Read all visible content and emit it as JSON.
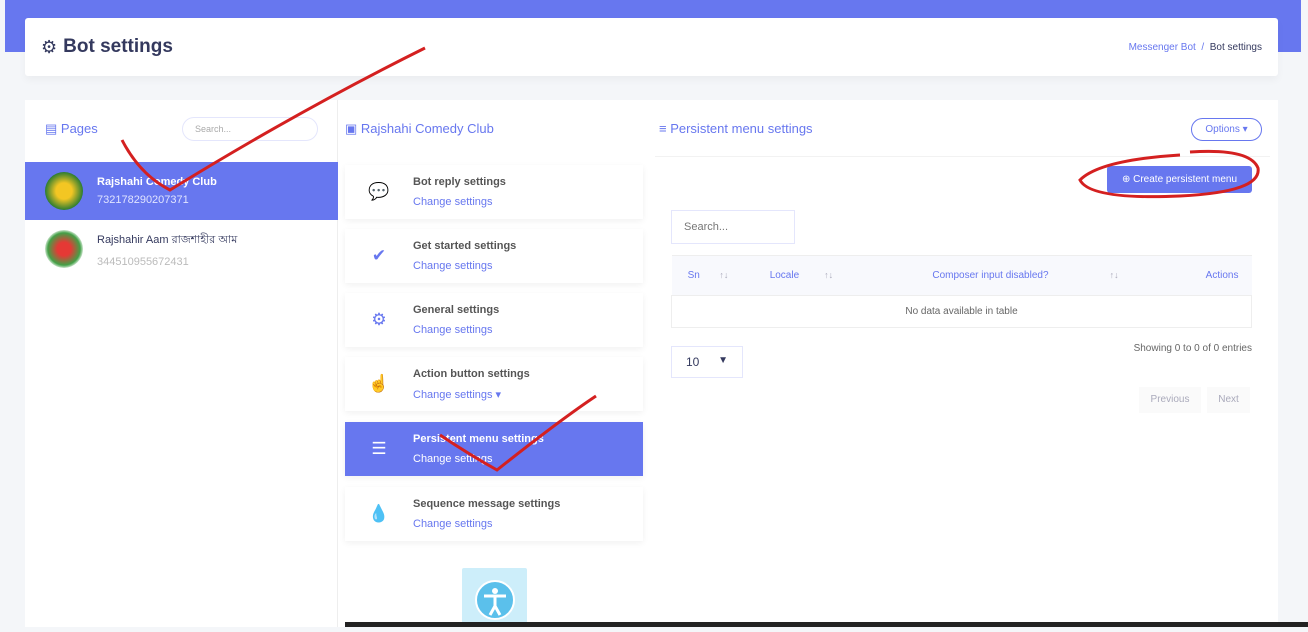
{
  "header": {
    "title": "Bot settings",
    "breadcrumb": [
      "Messenger Bot",
      "Bot settings"
    ]
  },
  "pages_panel": {
    "title": "Pages",
    "search_placeholder": "Search...",
    "pages": [
      {
        "name": "Rajshahi Comedy Club",
        "id": "732178290207371",
        "active": true
      },
      {
        "name": "Rajshahir Aam রাজশাহীর আম",
        "id": "344510955672431",
        "active": false
      }
    ]
  },
  "settings_panel": {
    "title": "Rajshahi Comedy Club",
    "items": [
      {
        "title": "Bot reply settings",
        "link": "Change settings",
        "icon": "comments-icon"
      },
      {
        "title": "Get started settings",
        "link": "Change settings",
        "icon": "check-circle-icon"
      },
      {
        "title": "General settings",
        "link": "Change settings",
        "icon": "gear-icon"
      },
      {
        "title": "Action button settings",
        "link": "Change settings",
        "icon": "hand-pointer-icon"
      },
      {
        "title": "Persistent menu settings",
        "link": "Change settings",
        "icon": "bars-icon",
        "active": true
      },
      {
        "title": "Sequence message settings",
        "link": "Change settings",
        "icon": "droplet-icon"
      }
    ]
  },
  "persistent": {
    "title": "Persistent menu settings",
    "options": "Options",
    "create": "Create persistent menu",
    "search_placeholder": "Search...",
    "columns": [
      "Sn",
      "Locale",
      "Composer input disabled?",
      "Actions"
    ],
    "empty": "No data available in table",
    "page_length": "10",
    "info": "Showing 0 to 0 of 0 entries",
    "prev": "Previous",
    "next": "Next"
  },
  "colors": {
    "primary": "#6777ef",
    "annotation": "#d42020"
  }
}
